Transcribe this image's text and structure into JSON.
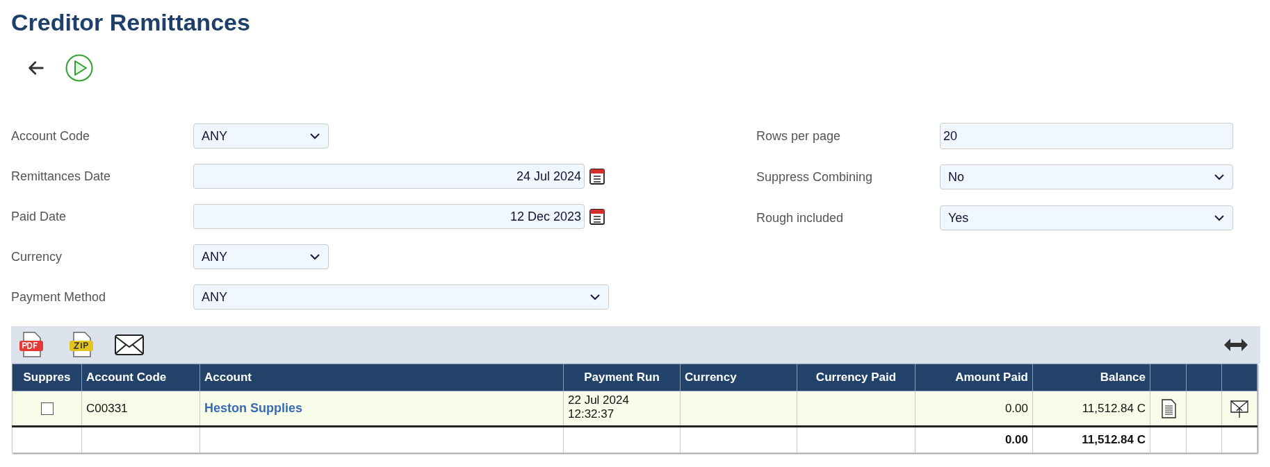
{
  "title": "Creditor Remittances",
  "filters_left": [
    {
      "label": "Account Code",
      "kind": "select",
      "value": "ANY"
    },
    {
      "label": "Remittances Date",
      "kind": "date",
      "value": "24 Jul 2024"
    },
    {
      "label": "Paid Date",
      "kind": "date",
      "value": "12 Dec 2023"
    },
    {
      "label": "Currency",
      "kind": "select",
      "value": "ANY"
    },
    {
      "label": "Payment Method",
      "kind": "select",
      "value": "ANY"
    }
  ],
  "filters_right": [
    {
      "label": "Rows per page",
      "kind": "text",
      "value": "20"
    },
    {
      "label": "Suppress Combining",
      "kind": "select",
      "value": "No"
    },
    {
      "label": "Rough included",
      "kind": "select",
      "value": "Yes"
    }
  ],
  "table": {
    "columns": [
      "Suppres",
      "Account Code",
      "Account",
      "Payment Run",
      "Currency",
      "Currency Paid",
      "Amount Paid",
      "Balance"
    ],
    "rows": [
      {
        "suppress": false,
        "account_code": "C00331",
        "account": "Heston Supplies",
        "payment_run": [
          "22 Jul 2024",
          "12:32:37"
        ],
        "amount_paid": "0.00",
        "balance": "11,512.84 C"
      }
    ],
    "totals": {
      "amount_paid": "0.00",
      "balance": "11,512.84 C"
    }
  }
}
